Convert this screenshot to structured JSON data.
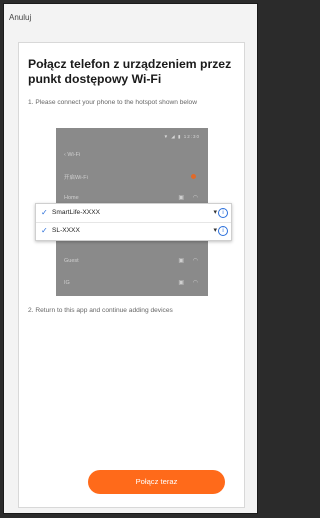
{
  "topbar": {
    "cancel_label": "Anuluj"
  },
  "content": {
    "title": "Połącz telefon z urządzeniem przez punkt dostępowy Wi‑Fi",
    "step1": "1. Please connect your phone to the hotspot shown below",
    "step2": "2. Return to this app and continue adding devices"
  },
  "phone_illustration": {
    "status": "▼ ◢ ▮ 12:30",
    "rows": [
      {
        "label": "‹ Wi-Fi"
      },
      {
        "label": "开启Wi-Fi"
      },
      {
        "label": "Home"
      }
    ],
    "bottom_rows": [
      {
        "label": "Guest"
      },
      {
        "label": "IG"
      }
    ],
    "popup": [
      {
        "name": "SmartLife-XXXX"
      },
      {
        "name": "SL-XXXX"
      }
    ],
    "accent_color": "#e06a2a"
  },
  "cta": {
    "label": "Połącz teraz",
    "color": "#ff6a1a"
  },
  "icons": {
    "check": "✓",
    "wifi": "❖",
    "lock": "🔒",
    "info": "i"
  }
}
